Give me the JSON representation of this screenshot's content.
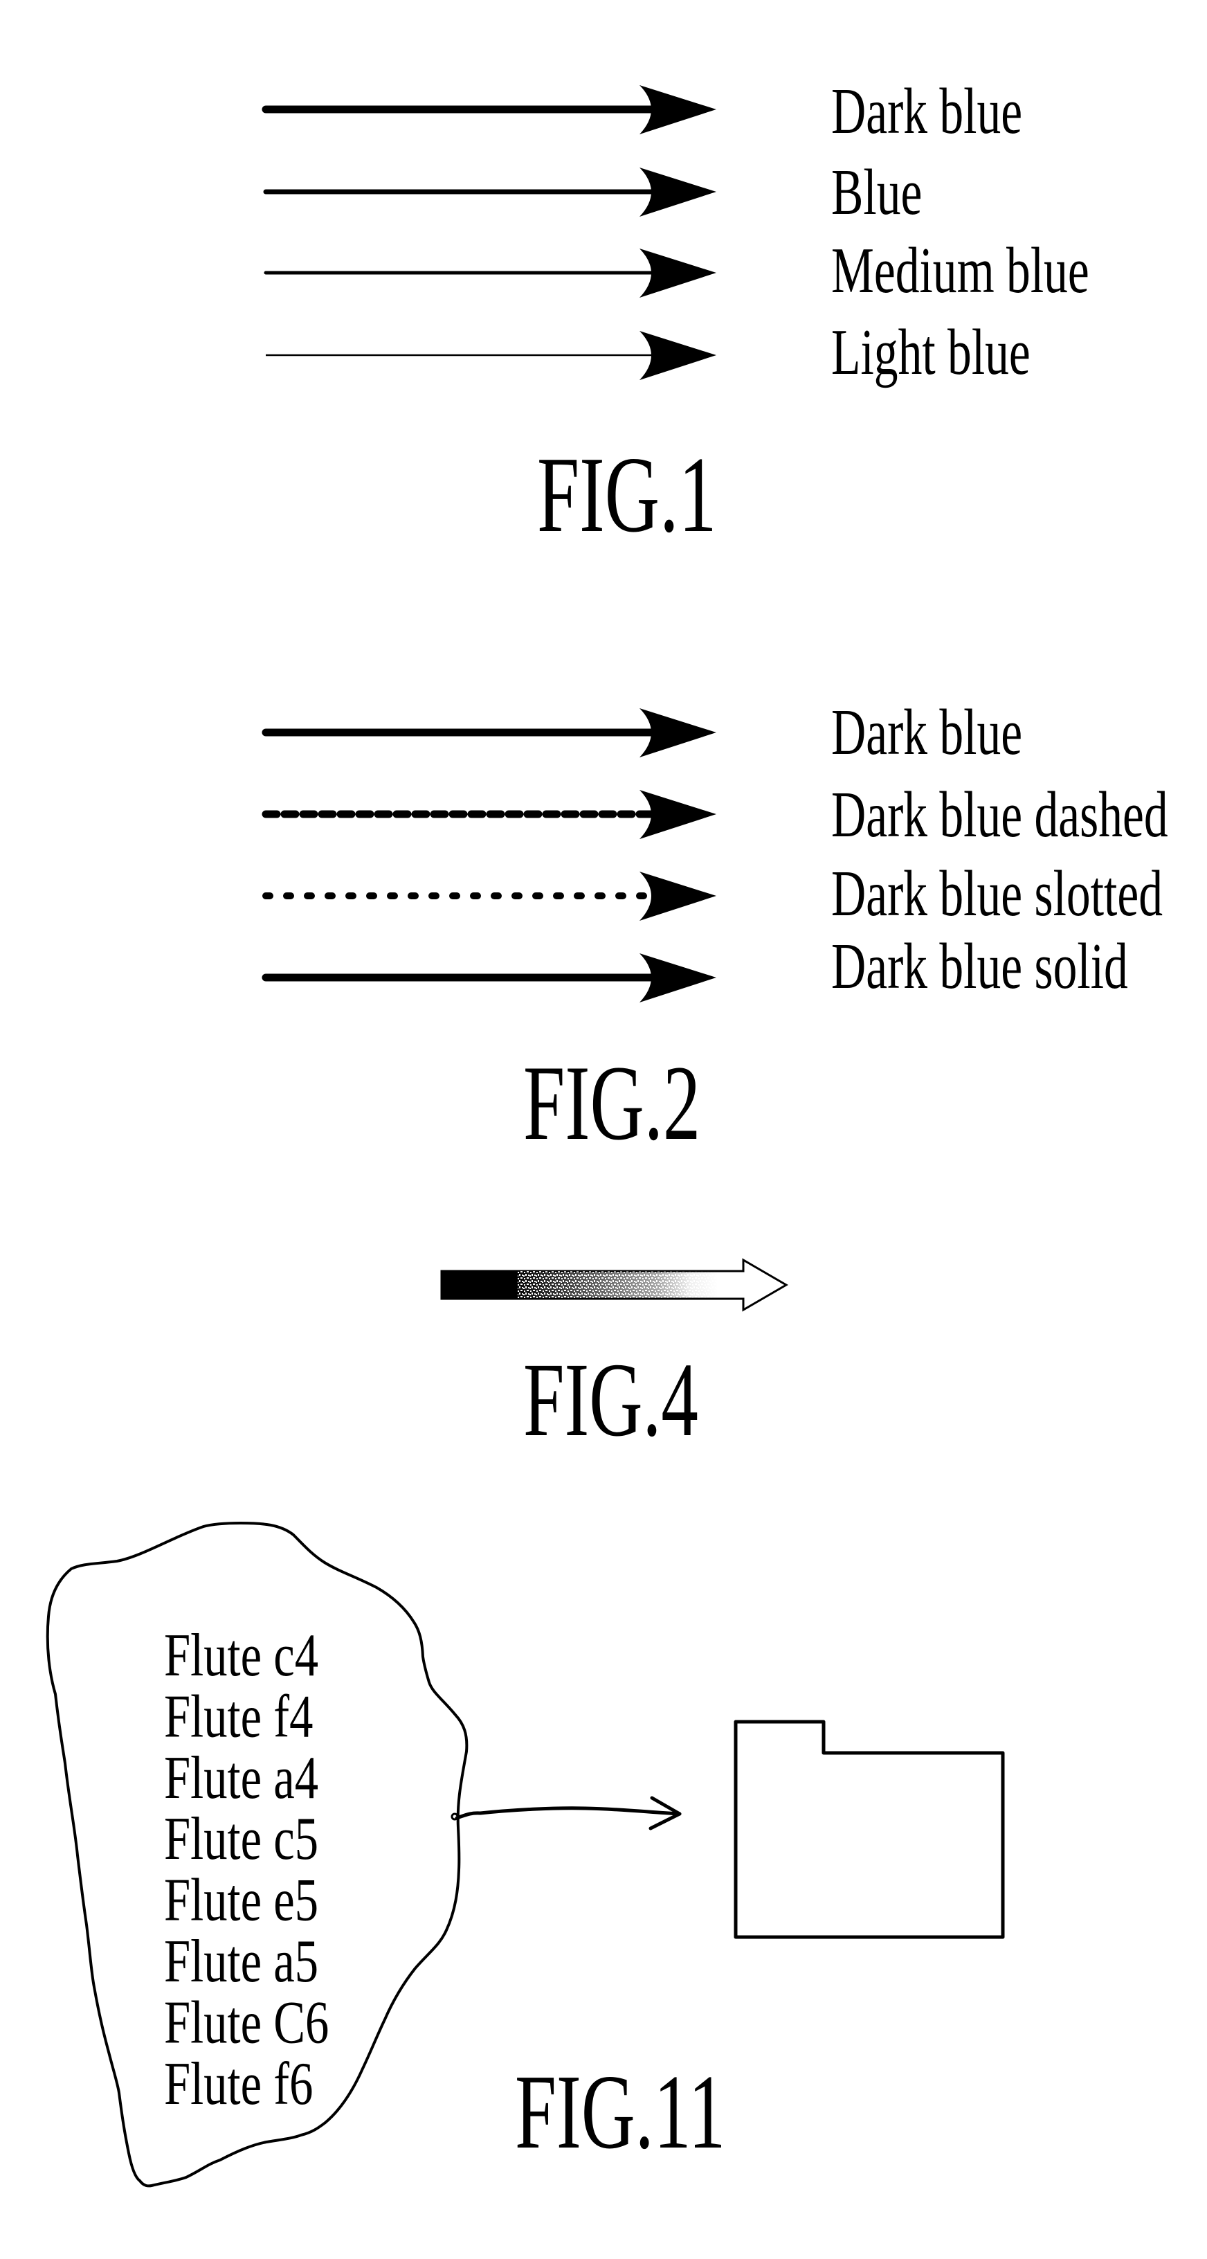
{
  "figures": {
    "fig1": {
      "caption": "FIG.1",
      "arrows": [
        {
          "label": "Dark blue",
          "line_style": "solid",
          "weight": "heaviest"
        },
        {
          "label": "Blue",
          "line_style": "solid",
          "weight": "heavy"
        },
        {
          "label": "Medium blue",
          "line_style": "solid",
          "weight": "medium"
        },
        {
          "label": "Light blue",
          "line_style": "solid",
          "weight": "thin"
        }
      ]
    },
    "fig2": {
      "caption": "FIG.2",
      "arrows": [
        {
          "label": "Dark blue",
          "line_style": "solid"
        },
        {
          "label": "Dark blue dashed",
          "line_style": "dashed"
        },
        {
          "label": "Dark blue slotted",
          "line_style": "dotted"
        },
        {
          "label": "Dark blue solid",
          "line_style": "solid"
        }
      ]
    },
    "fig4": {
      "caption": "FIG.4",
      "gradient_arrow": {
        "from_color": "#000000",
        "to_color": "#ffffff",
        "direction": "right"
      }
    },
    "fig11": {
      "caption": "FIG.11",
      "group_items": [
        "Flute c4",
        "Flute f4",
        "Flute a4",
        "Flute c5",
        "Flute e5",
        "Flute a5",
        "Flute C6",
        "Flute f6"
      ],
      "target": "folder-icon"
    }
  },
  "colors": {
    "ink": "#000000",
    "background": "#ffffff"
  }
}
